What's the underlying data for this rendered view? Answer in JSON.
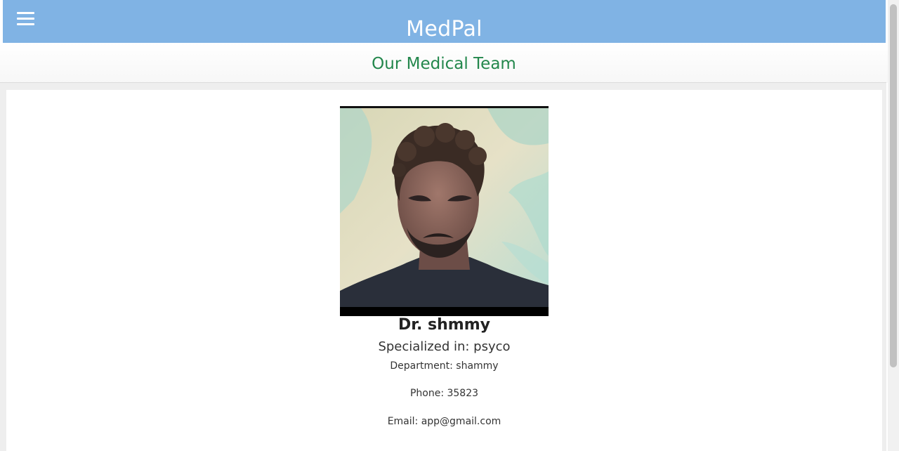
{
  "app": {
    "title": "MedPal",
    "accent_color": "#80b3e4"
  },
  "menu": {
    "icon": "hamburger-menu-icon"
  },
  "section": {
    "title": "Our Medical Team",
    "title_color": "#23874c"
  },
  "doctor": {
    "name": "Dr. shmmy",
    "specialization": "Specialized in: psyco",
    "department": "Department: shammy",
    "phone": "Phone: 35823",
    "email": "Email: app@gmail.com",
    "photo_alt": "Dr. shmmy"
  }
}
